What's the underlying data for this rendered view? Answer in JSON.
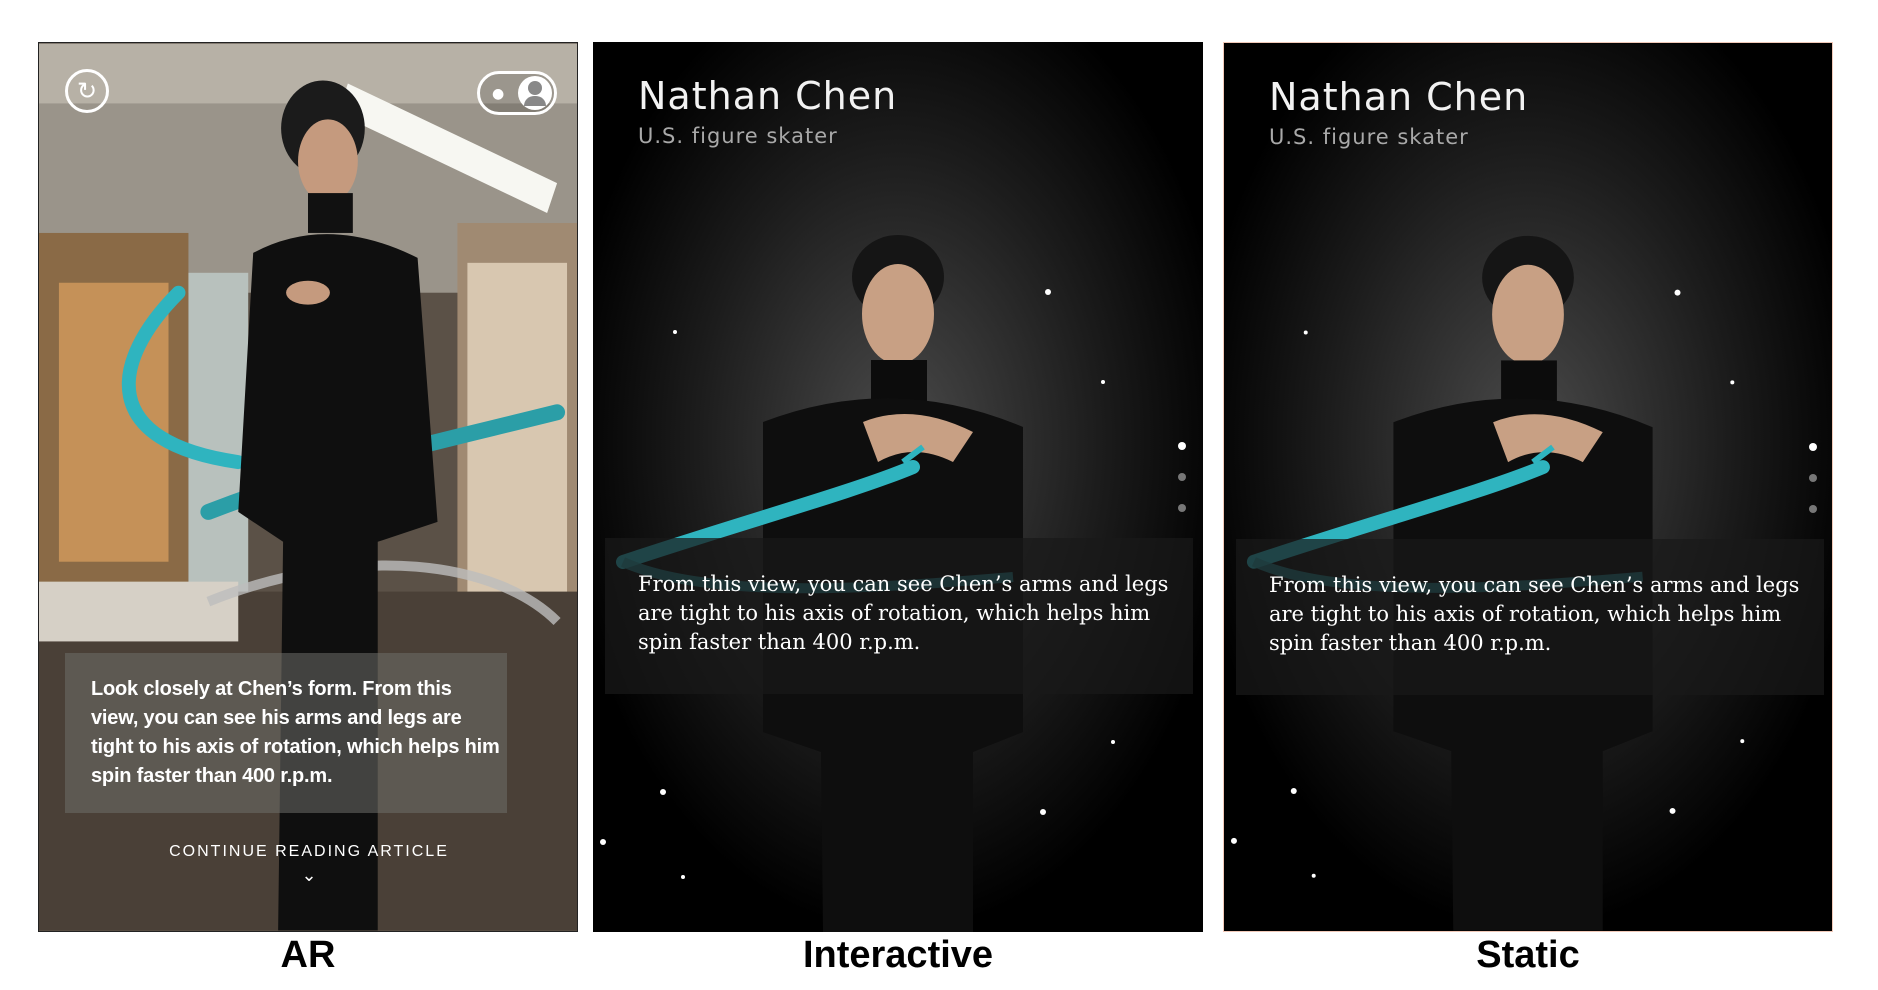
{
  "panels": {
    "ar": {
      "caption": "Look closely at Chen’s form. From this view, you can see his arms and legs are tight to his axis of rotation, which helps him spin faster than 400 r.p.m.",
      "continue_label": "CONTINUE READING ARTICLE",
      "chevron": "⌄",
      "replay_icon": "↻",
      "toggle_icon": "●"
    },
    "interactive": {
      "name": "Nathan Chen",
      "subtitle": "U.S. figure skater",
      "caption": "From this view, you can see Chen’s arms and legs are tight to his axis of rotation, which helps him spin faster than 400 r.p.m."
    },
    "static": {
      "name": "Nathan Chen",
      "subtitle": "U.S. figure skater",
      "caption": "From this view, you can see Chen’s arms and legs are tight to his axis of rotation, which helps him spin faster than 400 r.p.m."
    }
  },
  "labels": {
    "ar": "AR",
    "interactive": "Interactive",
    "static": "Static"
  },
  "colors": {
    "ribbon": "#2fb4bf",
    "background_dark": "#000000",
    "label_text": "#000000"
  }
}
